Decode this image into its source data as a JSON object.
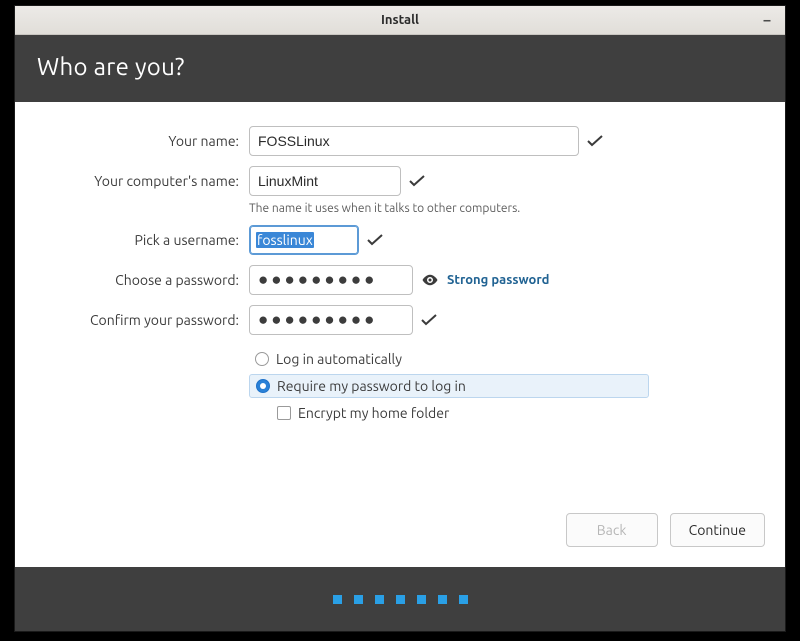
{
  "window": {
    "title": "Install",
    "minimize_glyph": "–"
  },
  "header": {
    "title": "Who are you?"
  },
  "labels": {
    "name": "Your name:",
    "computer": "Your computer's name:",
    "computer_hint": "The name it uses when it talks to other computers.",
    "username": "Pick a username:",
    "password": "Choose a password:",
    "confirm": "Confirm your password:"
  },
  "values": {
    "name": "FOSSLinux",
    "computer": "LinuxMint",
    "username": "fosslinux",
    "password_mask": "●●●●●●●●●",
    "confirm_mask": "●●●●●●●●●",
    "strength": "Strong password"
  },
  "options": {
    "auto_login": "Log in automatically",
    "require_pw": "Require my password to log in",
    "encrypt": "Encrypt my home folder",
    "selected": "require_pw"
  },
  "buttons": {
    "back": "Back",
    "continue": "Continue"
  },
  "progress": {
    "steps": 7
  }
}
